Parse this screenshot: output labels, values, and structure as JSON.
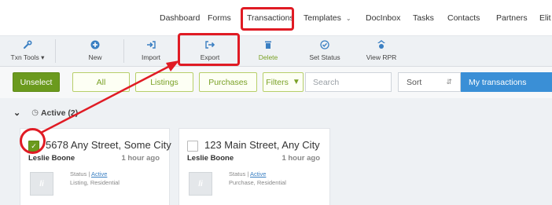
{
  "nav": {
    "items": [
      "Dashboard",
      "Forms",
      "Transactions",
      "Templates",
      "DocInbox",
      "Tasks",
      "Contacts",
      "Partners",
      "Elit"
    ]
  },
  "toolbar": {
    "txn_tools": "Txn Tools",
    "new": "New",
    "import": "Import",
    "export": "Export",
    "delete": "Delete",
    "set_status": "Set Status",
    "view_rpr": "View RPR"
  },
  "filters": {
    "unselect": "Unselect",
    "all": "All",
    "listings": "Listings",
    "purchases": "Purchases",
    "filters": "Filters",
    "search_placeholder": "Search",
    "sort": "Sort",
    "my_transactions": "My transactions"
  },
  "section": {
    "title": "Active (2)"
  },
  "cards": [
    {
      "address": "5678 Any Street, Some City",
      "agent": "Leslie Boone",
      "time": "1 hour ago",
      "status_label": "Status |",
      "status_value": "Active",
      "type": "Listing, Residential",
      "checked": true
    },
    {
      "address": "123 Main Street, Any City",
      "agent": "Leslie Boone",
      "time": "1 hour ago",
      "status_label": "Status |",
      "status_value": "Active",
      "type": "Purchase, Residential",
      "checked": false
    }
  ],
  "colors": {
    "highlight": "#e01b24",
    "accent_green": "#6b9a1e",
    "accent_blue": "#3a8fd6"
  }
}
